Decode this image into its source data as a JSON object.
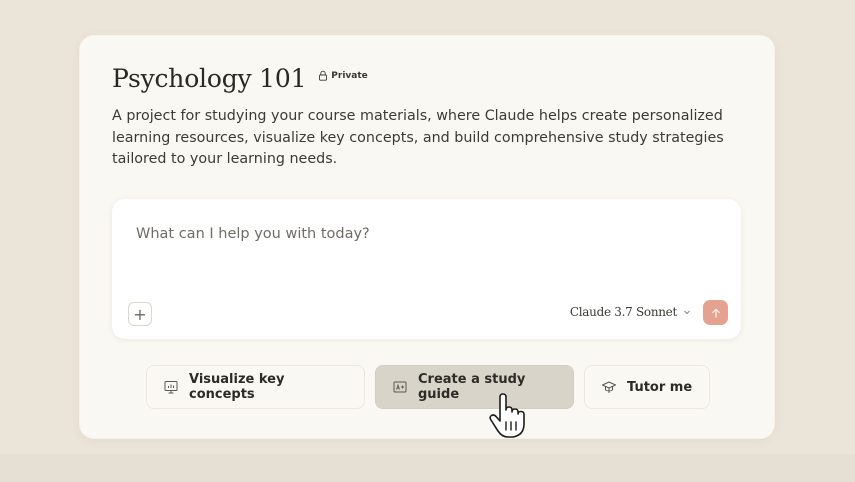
{
  "project": {
    "title": "Psychology 101",
    "visibility": "Private",
    "description": "A project for studying your course materials, where Claude helps create personalized learning resources, visualize key concepts, and build comprehensive study strategies tailored to your learning needs."
  },
  "composer": {
    "placeholder": "What can I help you with today?",
    "value": "",
    "model": "Claude 3.7 Sonnet",
    "plus_label": "+"
  },
  "actions": [
    {
      "label": "Visualize key concepts",
      "icon": "presentation-chart-icon"
    },
    {
      "label": "Create a study guide",
      "icon": "study-guide-icon",
      "state": "hovered"
    },
    {
      "label": "Tutor me",
      "icon": "graduation-cap-icon"
    }
  ],
  "colors": {
    "background": "#ebe4d8",
    "card": "#faf8f3",
    "send_button": "#e4a390",
    "active_action": "#d9d4ca"
  }
}
